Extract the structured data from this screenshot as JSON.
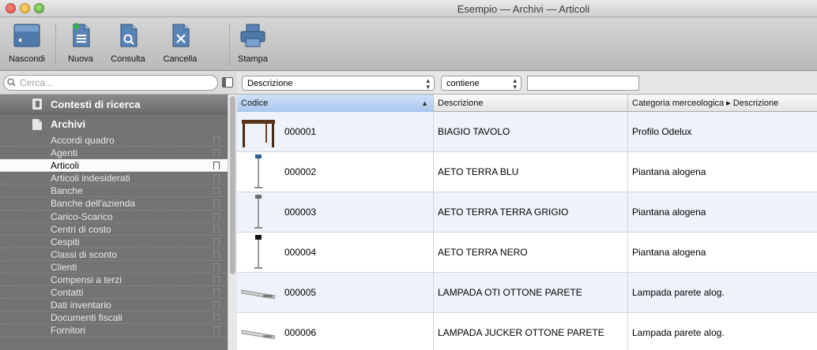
{
  "window": {
    "title": "Esempio — Archivi — Articoli"
  },
  "toolbar": {
    "buttons": [
      {
        "label": "Nascondi",
        "icon": "sidebar-hide-icon"
      },
      {
        "label": "Nuova",
        "icon": "new-document-icon"
      },
      {
        "label": "Consulta",
        "icon": "view-document-icon"
      },
      {
        "label": "Cancella",
        "icon": "delete-document-icon"
      },
      {
        "label": "Stampa",
        "icon": "printer-icon"
      }
    ]
  },
  "search": {
    "placeholder": "Cerca..."
  },
  "filter": {
    "field": "Descrizione",
    "operator": "contiene",
    "value": ""
  },
  "sidebar": {
    "sections": [
      {
        "label": "Contesti di ricerca",
        "icon": "search-context-icon"
      },
      {
        "label": "Archivi",
        "icon": "archive-icon"
      }
    ],
    "items": [
      {
        "label": "Accordi quadro"
      },
      {
        "label": "Agenti"
      },
      {
        "label": "Articoli",
        "selected": true
      },
      {
        "label": "Articoli indesiderati"
      },
      {
        "label": "Banche"
      },
      {
        "label": "Banche dell'azienda"
      },
      {
        "label": "Carico-Scarico"
      },
      {
        "label": "Centri di costo"
      },
      {
        "label": "Cespiti"
      },
      {
        "label": "Classi di sconto"
      },
      {
        "label": "Clienti"
      },
      {
        "label": "Compensi a terzi"
      },
      {
        "label": "Contatti"
      },
      {
        "label": "Dati inventario"
      },
      {
        "label": "Documenti fiscali"
      },
      {
        "label": "Fornitori"
      }
    ]
  },
  "table": {
    "columns": [
      "Codice",
      "Descrizione",
      "Categoria merceologica ▸ Descrizione"
    ],
    "sorted_column": "Codice",
    "rows": [
      {
        "codice": "000001",
        "descrizione": "BIAGIO TAVOLO",
        "categoria": "Profilo Odelux",
        "thumb": "table-thumbnail"
      },
      {
        "codice": "000002",
        "descrizione": "AETO TERRA BLU",
        "categoria": "Piantana alogena",
        "thumb": "floor-lamp-thumbnail"
      },
      {
        "codice": "000003",
        "descrizione": "AETO TERRA TERRA GRIGIO",
        "categoria": "Piantana alogena",
        "thumb": "floor-lamp-thumbnail"
      },
      {
        "codice": "000004",
        "descrizione": "AETO TERRA NERO",
        "categoria": "Piantana alogena",
        "thumb": "floor-lamp-thumbnail"
      },
      {
        "codice": "000005",
        "descrizione": "LAMPADA OTI OTTONE PARETE",
        "categoria": "Lampada parete alog.",
        "thumb": "wall-lamp-thumbnail"
      },
      {
        "codice": "000006",
        "descrizione": "LAMPADA JUCKER OTTONE PARETE",
        "categoria": "Lampada parete alog.",
        "thumb": "wall-lamp-thumbnail"
      }
    ]
  },
  "colors": {
    "sidebar_bg": "#737373",
    "selection": "#a9c7ee",
    "row_alt": "#eef3fb"
  }
}
